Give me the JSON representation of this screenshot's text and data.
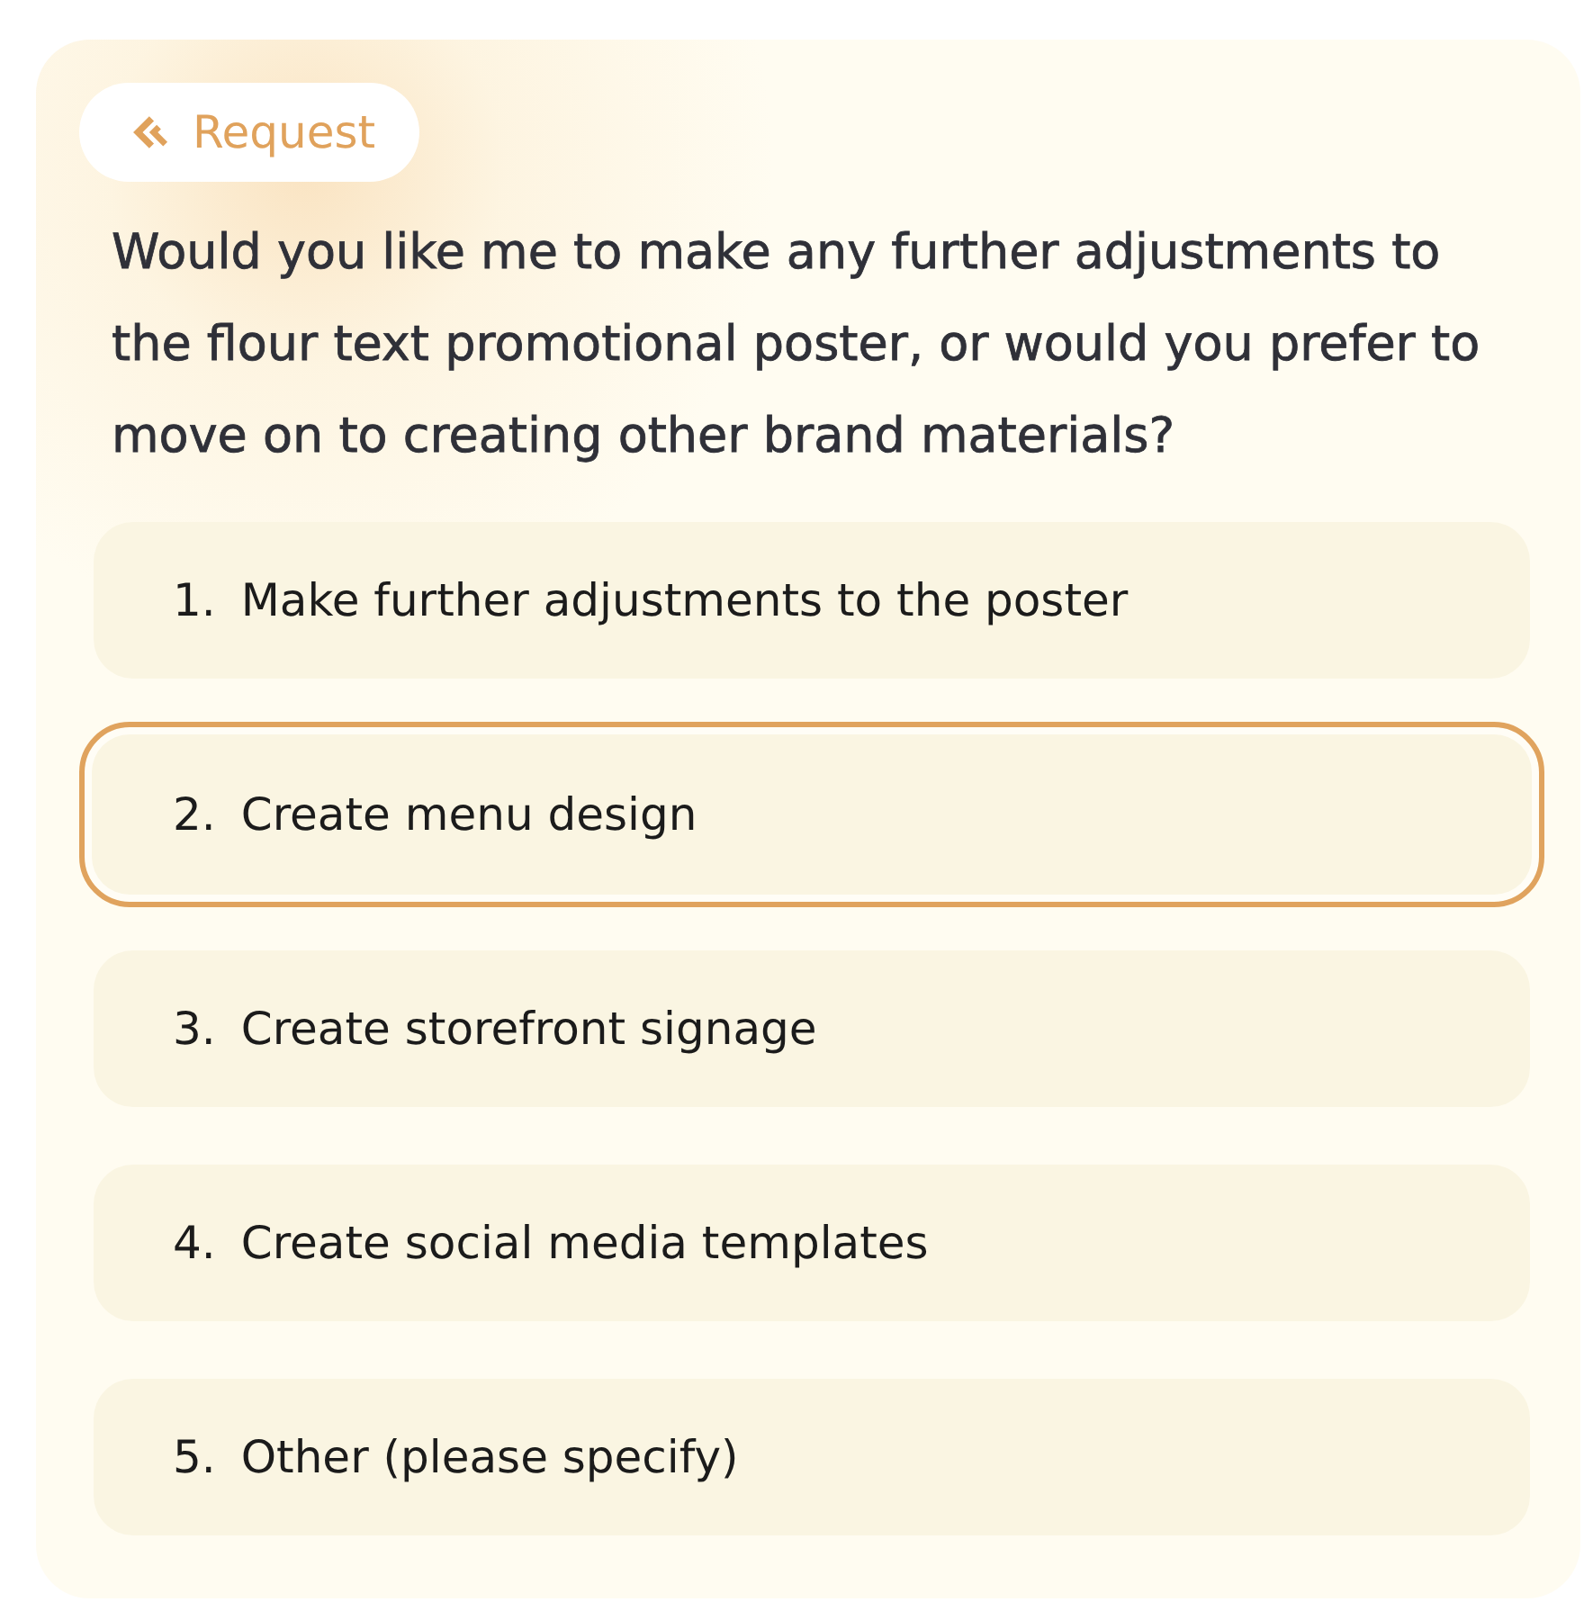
{
  "tag": {
    "label": "Request"
  },
  "question": "Would you like me to make any further adjustments to the flour text promotional poster, or would you prefer to move on to creating other brand materials?",
  "options": [
    {
      "number": "1.",
      "label": "Make further adjustments to the poster",
      "selected": false
    },
    {
      "number": "2.",
      "label": "Create menu design",
      "selected": true
    },
    {
      "number": "3.",
      "label": "Create storefront signage",
      "selected": false
    },
    {
      "number": "4.",
      "label": "Create social media templates",
      "selected": false
    },
    {
      "number": "5.",
      "label": "Other (please specify)",
      "selected": false
    }
  ]
}
